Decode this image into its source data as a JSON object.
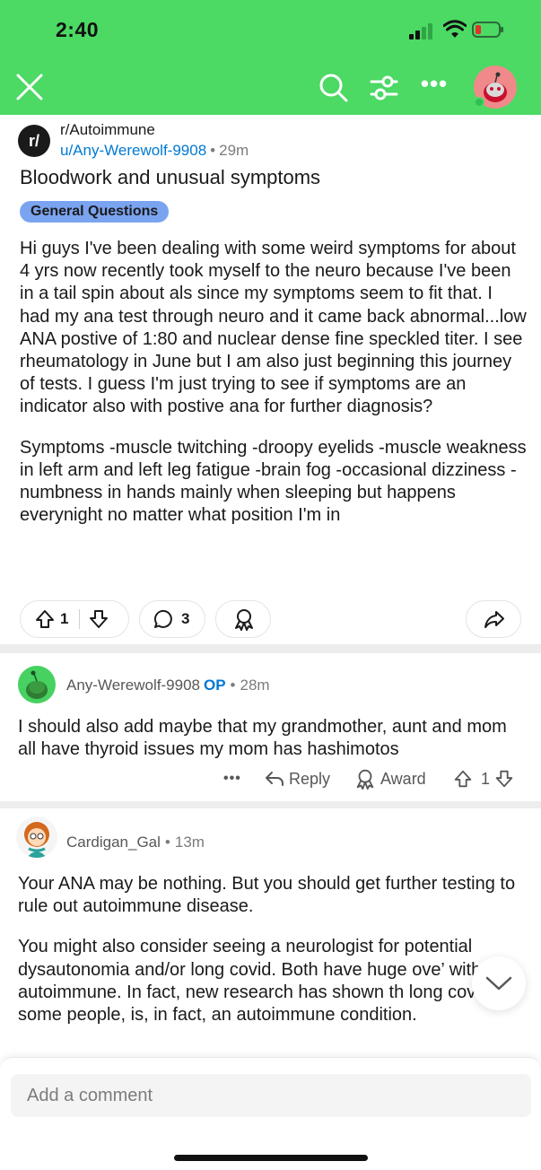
{
  "status_bar": {
    "time": "2:40"
  },
  "post": {
    "subreddit": "r/Autoimmune",
    "sub_icon_text": "r/",
    "author": "u/Any-Werewolf-9908",
    "time": "29m",
    "title": "Bloodwork and unusual symptoms",
    "flair": "General Questions",
    "flair_color": "#7ba4f0",
    "body": [
      "Hi guys I've been dealing with some weird symptoms for about 4 yrs now recently took myself to the neuro because I've been in a tail spin about als since my symptoms seem to fit that. I had my ana test through neuro and it came back abnormal...low ANA postive of 1:80 and nuclear dense fine speckled titer. I see rheumatology in June but I am also just beginning this journey of tests. I guess I'm just trying to see if symptoms are an indicator also with postive ana for further diagnosis?",
      "Symptoms -muscle twitching -droopy eyelids -muscle weakness in left arm and left leg fatigue -brain fog -occasional dizziness -numbness in hands mainly when sleeping but happens everynight no matter what position I'm in"
    ],
    "upvotes": "1",
    "comments": "3"
  },
  "comments": [
    {
      "author": "Any-Werewolf-9908",
      "op_label": "OP",
      "time": "28m",
      "body": [
        "I should also add maybe that my grandmother, aunt and mom all have thyroid issues my mom has hashimotos"
      ],
      "more": "•••",
      "reply_label": "Reply",
      "award_label": "Award",
      "votes": "1"
    },
    {
      "author": "Cardigan_Gal",
      "time": "13m",
      "body": [
        "Your ANA may be nothing. But you should get further testing to rule out autoimmune disease.",
        "You might also consider seeing a neurologist for potential dysautonomia and/or long covid. Both have huge ove’ with autoimmune. In fact, new research has shown th long covid, in some people, is, in fact, an autoimmune condition."
      ]
    }
  ],
  "comment_input": {
    "placeholder": "Add a comment"
  },
  "colors": {
    "header_bg": "#4cd964",
    "link_blue": "#0079d3",
    "divider": "#ededed"
  },
  "icons": [
    "close-icon",
    "search-icon",
    "filter-icon",
    "more-icon",
    "avatar",
    "upvote-icon",
    "downvote-icon",
    "comment-icon",
    "award-icon",
    "share-icon",
    "reply-icon",
    "chevron-down-icon"
  ]
}
